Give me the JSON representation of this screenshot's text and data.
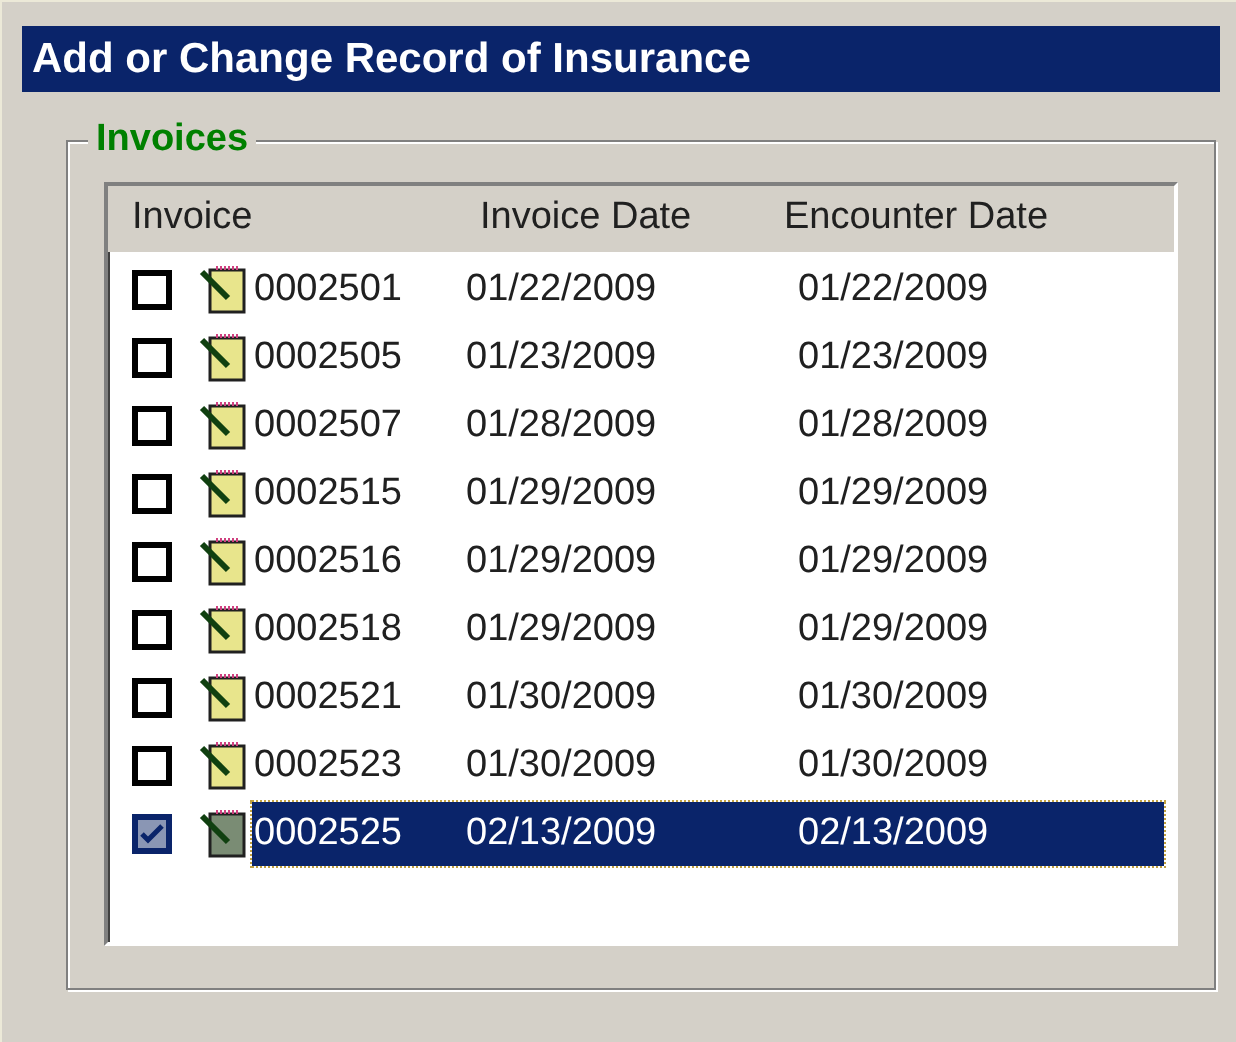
{
  "window": {
    "title": "Add or Change Record of Insurance"
  },
  "group": {
    "title": "Invoices"
  },
  "table": {
    "columns": [
      "Invoice",
      "Invoice Date",
      "Encounter Date"
    ],
    "rows": [
      {
        "invoice": "0002501",
        "invoice_date": "01/22/2009",
        "encounter_date": "01/22/2009",
        "checked": false,
        "selected": false
      },
      {
        "invoice": "0002505",
        "invoice_date": "01/23/2009",
        "encounter_date": "01/23/2009",
        "checked": false,
        "selected": false
      },
      {
        "invoice": "0002507",
        "invoice_date": "01/28/2009",
        "encounter_date": "01/28/2009",
        "checked": false,
        "selected": false
      },
      {
        "invoice": "0002515",
        "invoice_date": "01/29/2009",
        "encounter_date": "01/29/2009",
        "checked": false,
        "selected": false
      },
      {
        "invoice": "0002516",
        "invoice_date": "01/29/2009",
        "encounter_date": "01/29/2009",
        "checked": false,
        "selected": false
      },
      {
        "invoice": "0002518",
        "invoice_date": "01/29/2009",
        "encounter_date": "01/29/2009",
        "checked": false,
        "selected": false
      },
      {
        "invoice": "0002521",
        "invoice_date": "01/30/2009",
        "encounter_date": "01/30/2009",
        "checked": false,
        "selected": false
      },
      {
        "invoice": "0002523",
        "invoice_date": "01/30/2009",
        "encounter_date": "01/30/2009",
        "checked": false,
        "selected": false
      },
      {
        "invoice": "0002525",
        "invoice_date": "02/13/2009",
        "encounter_date": "02/13/2009",
        "checked": true,
        "selected": true
      }
    ]
  }
}
